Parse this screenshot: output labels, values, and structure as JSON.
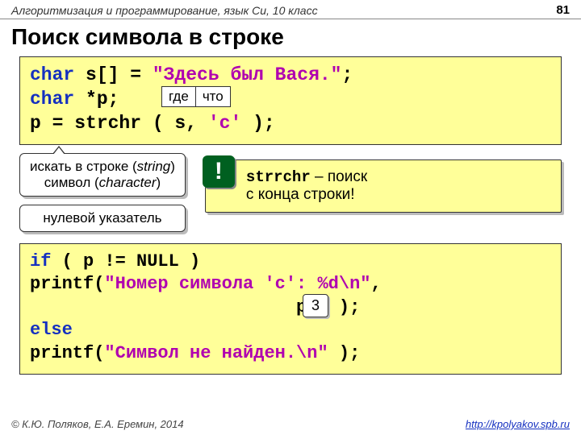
{
  "header": {
    "course": "Алгоритмизация и программирование, язык Си, 10 класс",
    "page": "81"
  },
  "title": "Поиск символа в строке",
  "code1": {
    "l1a": "char",
    "l1b": " s[] = ",
    "l1c": "\"Здесь был Вася.\"",
    "l1d": ";",
    "l2a": "char",
    "l2b": " *p;",
    "l3a": "p = strchr ( s, ",
    "l3b": "'с'",
    "l3c": " );"
  },
  "labels": {
    "where": "где",
    "what": "что"
  },
  "bubble1a": "искать в строке (",
  "bubble1b": "string",
  "bubble1c": ")",
  "bubble1d": "символ (",
  "bubble1e": "character",
  "bubble1f": ")",
  "bubble2": "нулевой указатель",
  "warn": {
    "excl": "!",
    "code": "strrchr",
    "t1": " – поиск",
    "t2": "с конца строки!"
  },
  "code2": {
    "l1a": "if",
    "l1b": " ( p != NULL )",
    "l2a": "  printf(",
    "l2b": "\"Номер символа 'c': %d\\n\"",
    "l2c": ",",
    "l3": "                         p-s );",
    "l4": "else",
    "l5a": "  printf(",
    "l5b": "\"Символ не найден.\\n\"",
    "l5c": " );"
  },
  "result": "3",
  "footer": {
    "copy": "© К.Ю. Поляков, Е.А. Еремин, 2014",
    "url": "http://kpolyakov.spb.ru"
  }
}
